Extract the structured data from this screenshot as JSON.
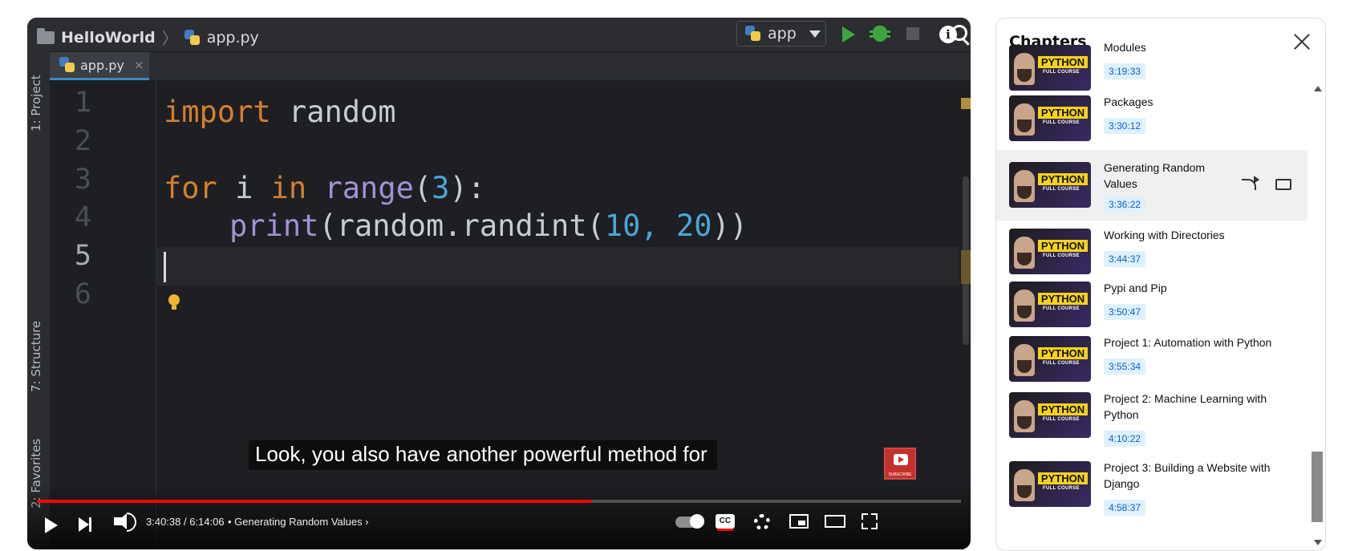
{
  "ide": {
    "project_name": "HelloWorld",
    "file_name": "app.py",
    "run_config": "app",
    "tab_label": "app.py",
    "tab_close": "×",
    "side_tabs": [
      "1: Project",
      "7: Structure",
      "2: Favorites"
    ],
    "line_numbers": [
      "1",
      "2",
      "3",
      "4",
      "5",
      "6"
    ],
    "code": {
      "l1_kw": "import",
      "l1_rest": " random",
      "l3_kw1": "for",
      "l3_var": " i ",
      "l3_kw2": "in",
      "l3_fn": " range",
      "l3_open": "(",
      "l3_num": "3",
      "l3_close": "):",
      "l4_fn": "print",
      "l4_mid": "(random.randint(",
      "l4_num1": "10",
      "l4_comma": ", ",
      "l4_num2": "20",
      "l4_end": "))"
    }
  },
  "player": {
    "caption": "Look, you also have another powerful method for",
    "subscribe_badge": "SUBSCRIBE",
    "time": "3:40:38 / 6:14:06",
    "chapter_label": "• Generating Random Values ›",
    "progress_played": 0.6,
    "cc_label": "CC"
  },
  "chapters": {
    "title": "Chapters",
    "thumb_label": "PYTHON",
    "thumb_sub": "FULL COURSE",
    "items": [
      {
        "name": "Modules",
        "time": "3:19:33"
      },
      {
        "name": "Packages",
        "time": "3:30:12"
      },
      {
        "name": "Generating Random Values",
        "time": "3:36:22"
      },
      {
        "name": "Working with Directories",
        "time": "3:44:37"
      },
      {
        "name": "Pypi and Pip",
        "time": "3:50:47"
      },
      {
        "name": "Project 1: Automation with Python",
        "time": "3:55:34"
      },
      {
        "name": "Project 2: Machine Learning with Python",
        "time": "4:10:22"
      },
      {
        "name": "Project 3: Building a Website with Django",
        "time": "4:58:37"
      }
    ]
  },
  "colors": {
    "accent_red": "#ff0000",
    "keyword": "#d47f2e",
    "function": "#a48fd8",
    "number": "#4aa6d9",
    "timestamp_blue": "#065fd4"
  }
}
